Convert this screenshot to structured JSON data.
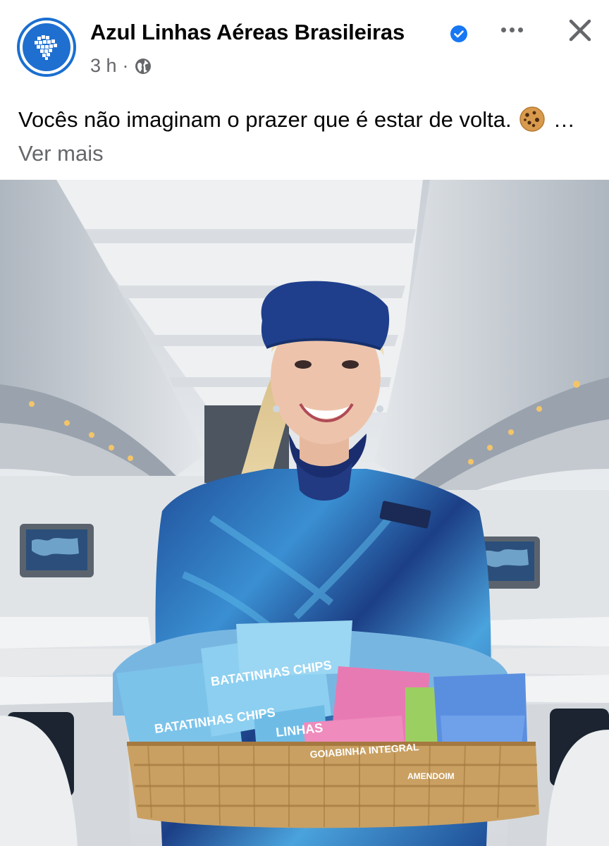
{
  "post": {
    "page_name": "Azul Linhas Aéreas Brasileiras",
    "time": "3 h",
    "separator": "·",
    "caption_text": "Vocês não imaginam o prazer que é estar de volta.",
    "caption_ellipsis": "…",
    "see_more": "Ver mais"
  },
  "photo": {
    "snack_labels": [
      "BATATINHAS CHIPS",
      "BATATINHAS CHIPS",
      "LINHAS",
      "GOIABINHA INTEGRAL",
      "AMENDOIM"
    ]
  },
  "icons": {
    "avatar": "azul-logo-icon",
    "verified": "verified-badge-icon",
    "audience": "globe-icon",
    "more": "more-options-icon",
    "close": "close-icon",
    "emoji": "cookie-emoji-icon"
  },
  "colors": {
    "brand": "#1a6fd1",
    "verified": "#1877f2",
    "secondary_text": "#65676b"
  }
}
